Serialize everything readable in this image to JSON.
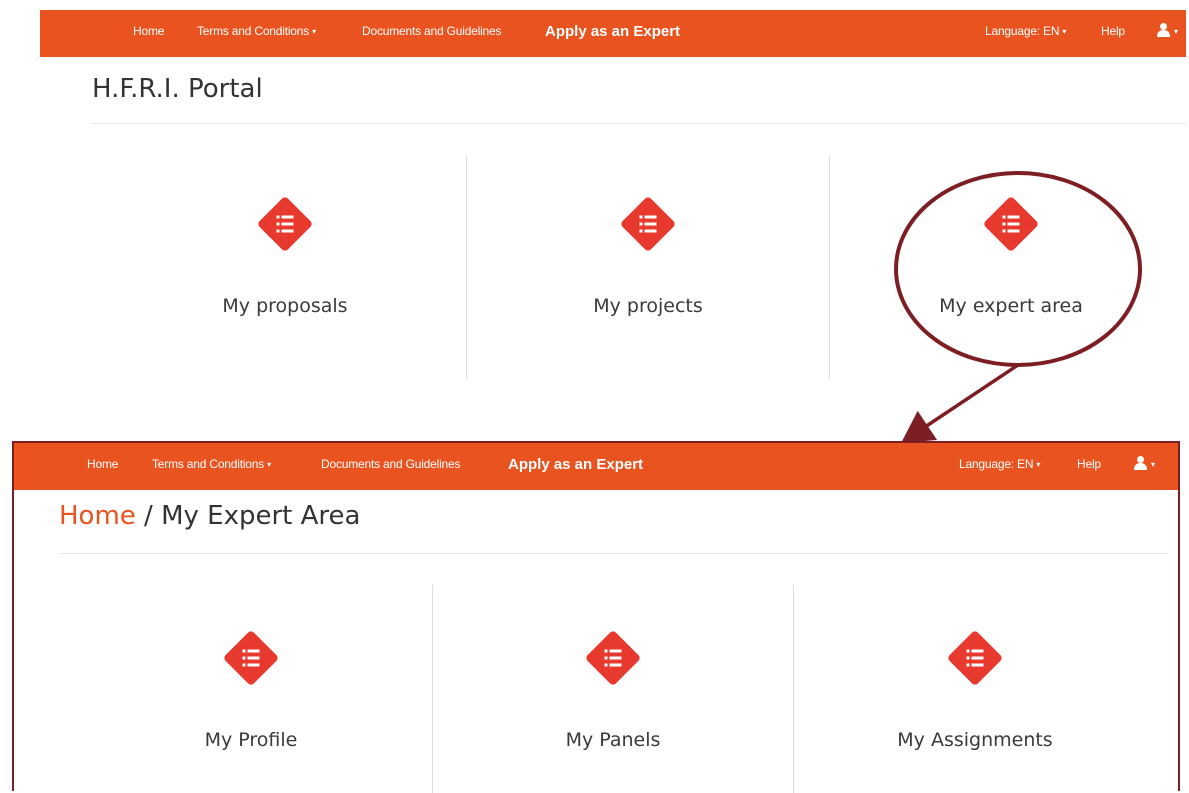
{
  "top_screen": {
    "nav": {
      "home": "Home",
      "terms": "Terms and Conditions",
      "documents": "Documents and Guidelines",
      "apply": "Apply as an Expert",
      "language": "Language: EN",
      "help": "Help"
    },
    "title": "H.F.R.I. Portal",
    "tiles": [
      {
        "label": "My proposals",
        "icon": "list-icon"
      },
      {
        "label": "My projects",
        "icon": "list-icon"
      },
      {
        "label": "My expert area",
        "icon": "list-icon"
      }
    ]
  },
  "bottom_screen": {
    "nav": {
      "home": "Home",
      "terms": "Terms and Conditions",
      "documents": "Documents and Guidelines",
      "apply": "Apply as an Expert",
      "language": "Language: EN",
      "help": "Help"
    },
    "breadcrumb": {
      "home": "Home",
      "separator": " / ",
      "current": "My Expert Area"
    },
    "tiles": [
      {
        "label": "My Profile",
        "icon": "list-icon"
      },
      {
        "label": "My Panels",
        "icon": "list-icon"
      },
      {
        "label": "My Assignments",
        "icon": "list-icon"
      }
    ]
  },
  "colors": {
    "brand_orange": "#e9531f",
    "icon_red": "#e8392f",
    "annotation_maroon": "#7d1e24"
  }
}
